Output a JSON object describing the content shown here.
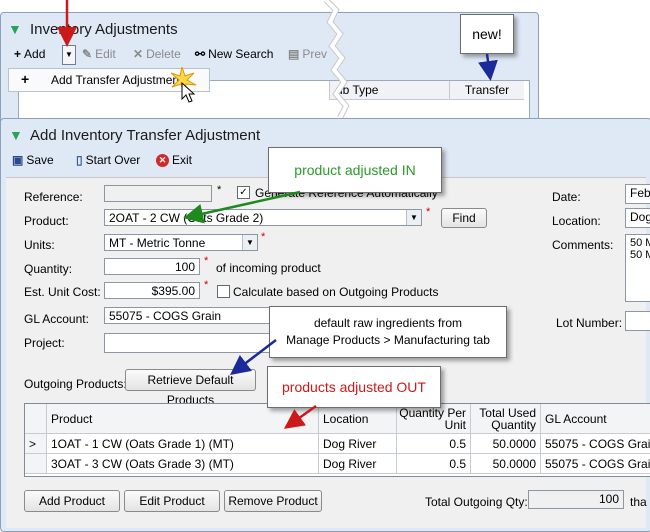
{
  "back_window": {
    "title": "Inventory Adjustments",
    "toolbar": {
      "add_label": "Add",
      "edit_label": "Edit",
      "delete_label": "Delete",
      "new_search_label": "New Search",
      "preview_label": "Prev"
    },
    "dropdown_item": "Add Transfer Adjustment",
    "grid_headers": [
      "ub Type",
      "Transfer"
    ]
  },
  "callouts": {
    "new": "new!",
    "product_in": "product adjusted IN",
    "default_raw": "default raw ingredients from\nManage Products > Manufacturing tab",
    "products_out": "products adjusted OUT"
  },
  "front_window": {
    "title": "Add Inventory Transfer Adjustment",
    "toolbar": {
      "save_label": "Save",
      "start_over_label": "Start Over",
      "exit_label": "Exit"
    },
    "form": {
      "reference_label": "Reference:",
      "reference_value": "",
      "generate_label": "Generate Reference Automatically",
      "product_label": "Product:",
      "product_value": "2OAT - 2 CW (Oats Grade 2)",
      "find_label": "Find",
      "units_label": "Units:",
      "units_value": "MT - Metric Tonne",
      "quantity_label": "Quantity:",
      "quantity_value": "100",
      "incoming_label": "of incoming product",
      "est_cost_label": "Est. Unit Cost:",
      "est_cost_value": "$395.00",
      "calc_label": "Calculate based on Outgoing Products",
      "gl_label": "GL Account:",
      "gl_value": "55075 - COGS Grain",
      "project_label": "Project:",
      "project_value": "",
      "date_label": "Date:",
      "date_value": "Feb",
      "location_label": "Location:",
      "location_value": "Dog",
      "comments_label": "Comments:",
      "comments_value": "50 M\n50 M",
      "lot_label": "Lot Number:",
      "lot_value": ""
    },
    "outgoing": {
      "label": "Outgoing Products:",
      "retrieve_label": "Retrieve Default Products",
      "headers": {
        "product": "Product",
        "location": "Location",
        "qty_per_unit": "Quantity Per Unit",
        "total_used": "Total Used Quantity",
        "gl_account": "GL Account"
      },
      "rows": [
        {
          "marker": ">",
          "product": "1OAT - 1 CW (Oats Grade 1) (MT)",
          "location": "Dog River",
          "qty_per_unit": "0.5",
          "total_used": "50.0000",
          "gl_account": "55075 - COGS Grain"
        },
        {
          "marker": "",
          "product": "3OAT - 3 CW (Oats Grade 3) (MT)",
          "location": "Dog River",
          "qty_per_unit": "0.5",
          "total_used": "50.0000",
          "gl_account": "55075 - COGS Grain"
        }
      ],
      "add_product_label": "Add Product",
      "edit_product_label": "Edit Product",
      "remove_product_label": "Remove Product",
      "total_label": "Total Outgoing Qty:",
      "total_value": "100",
      "total_suffix": "tha"
    }
  },
  "colors": {
    "arrow_red": "#cc1a1a",
    "arrow_green": "#1e8a1e",
    "arrow_blue": "#1a2a9a",
    "callout_in_text": "#2a9a2a",
    "callout_out_text": "#d01818"
  }
}
